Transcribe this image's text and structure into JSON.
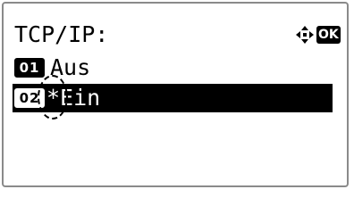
{
  "screen": {
    "title": "TCP/IP:",
    "nav_icon": "four-way-arrow-icon",
    "ok_label": "OK"
  },
  "menu": {
    "items": [
      {
        "number": "01",
        "label": "Aus",
        "selected": false
      },
      {
        "number": "02",
        "label": "*Ein",
        "selected": true
      }
    ]
  },
  "colors": {
    "foreground": "#000000",
    "background": "#ffffff",
    "border": "#8a8a8a"
  }
}
